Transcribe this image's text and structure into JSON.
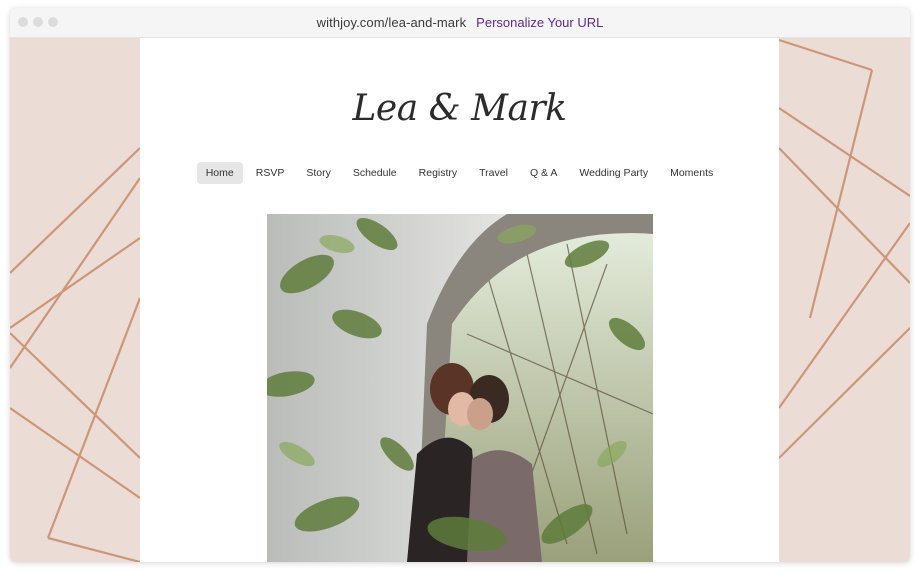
{
  "browser": {
    "url": "withjoy.com/lea-and-mark",
    "personalize_label": "Personalize Your URL"
  },
  "site": {
    "couple_title": "Lea & Mark",
    "nav": {
      "items": [
        {
          "label": "Home",
          "active": true
        },
        {
          "label": "RSVP"
        },
        {
          "label": "Story"
        },
        {
          "label": "Schedule"
        },
        {
          "label": "Registry"
        },
        {
          "label": "Travel"
        },
        {
          "label": "Q & A"
        },
        {
          "label": "Wedding Party"
        },
        {
          "label": "Moments"
        }
      ]
    }
  },
  "colors": {
    "background_blush": "#ecdcd6",
    "rose_gold_lines": "#c98f6e",
    "link_purple": "#5e2b8f"
  }
}
